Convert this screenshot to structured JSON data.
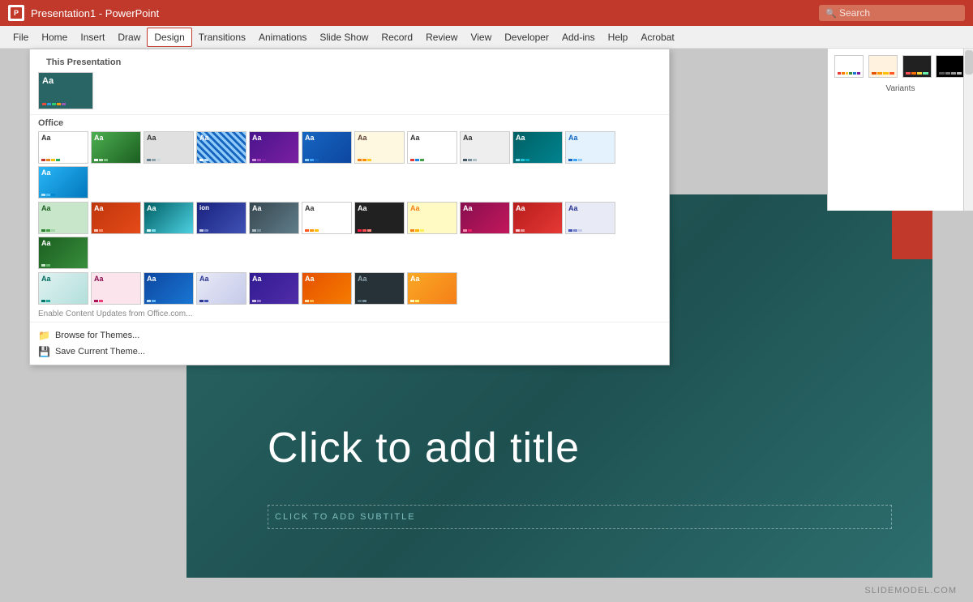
{
  "titleBar": {
    "title": "Presentation1 - PowerPoint",
    "searchPlaceholder": "Search"
  },
  "menuBar": {
    "items": [
      "File",
      "Home",
      "Insert",
      "Draw",
      "Design",
      "Transitions",
      "Animations",
      "Slide Show",
      "Record",
      "Review",
      "View",
      "Developer",
      "Add-ins",
      "Help",
      "Acrobat"
    ],
    "activeItem": "Design"
  },
  "themePanel": {
    "thisPresentationLabel": "This Presentation",
    "officeLabel": "Office",
    "enableText": "Enable Content Updates from Office.com...",
    "browseThemes": "Browse for Themes...",
    "saveTheme": "Save Current Theme...",
    "variantsLabel": "Variants"
  },
  "slide": {
    "titlePlaceholder": "Click to add title",
    "subtitlePlaceholder": "CLICK TO ADD SUBTITLE"
  },
  "watermark": "SLIDEMODEL.COM"
}
